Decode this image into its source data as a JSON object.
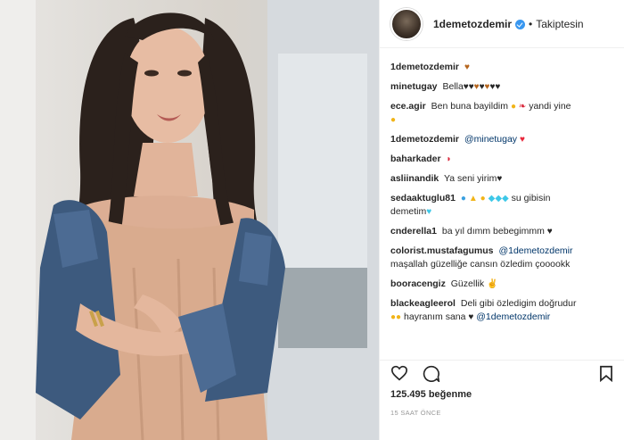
{
  "header": {
    "username": "1demetozdemir",
    "separator": "•",
    "follow_status": "Takiptesin"
  },
  "comments": [
    {
      "user": "1demetozdemir",
      "text": ""
    },
    {
      "user": "minetugay",
      "text": "Bella"
    },
    {
      "user": "ece.agir",
      "text": "Ben buna bayildim",
      "text2": "yandi yine"
    },
    {
      "user": "1demetozdemir",
      "mention": "@minetugay"
    },
    {
      "user": "baharkader",
      "text": ""
    },
    {
      "user": "asliinandik",
      "text": "Ya seni yirim"
    },
    {
      "user": "sedaaktuglu81",
      "text": "su gibisin",
      "text2": "demetim"
    },
    {
      "user": "cnderella1",
      "text": "ba yıl dımm bebegimmm"
    },
    {
      "user": "colorist.mustafagumus",
      "mention": "@1demetozdemir",
      "text": "maşallah güzelliğe cansın özledim çooookk"
    },
    {
      "user": "booracengiz",
      "text": "Güzellik"
    },
    {
      "user": "blackeagleerol",
      "text": "Deli gibi özledigim doğrudur",
      "text2": "hayranım sana",
      "mention": "@1demetozdemir"
    }
  ],
  "actions": {
    "like_icon": "heart-outline-icon",
    "comment_icon": "speech-bubble-icon",
    "save_icon": "bookmark-icon"
  },
  "likes_text": "125.495 beğenme",
  "time_text": "15 SAAT ÖNCE",
  "colors": {
    "verified": "#3897f0",
    "mention": "#003569",
    "text": "#262626",
    "muted": "#999999"
  }
}
